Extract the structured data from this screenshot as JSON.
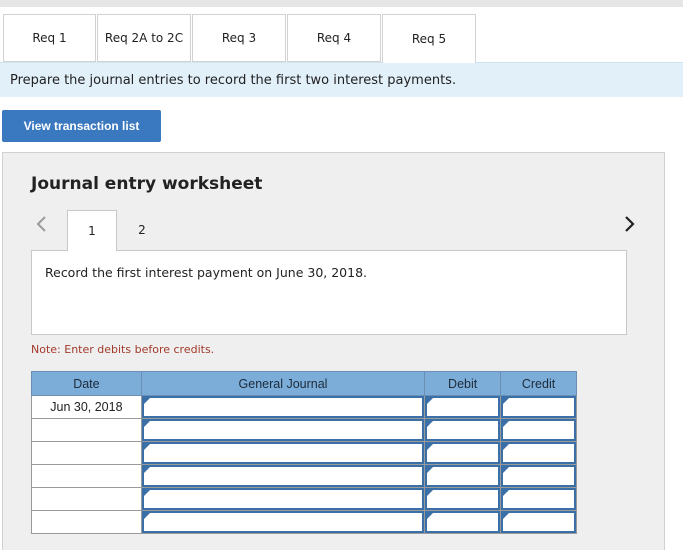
{
  "tabs": [
    {
      "label": "Req 1",
      "active": false
    },
    {
      "label": "Req 2A to 2C",
      "active": false
    },
    {
      "label": "Req 3",
      "active": false
    },
    {
      "label": "Req 4",
      "active": false
    },
    {
      "label": "Req 5",
      "active": true
    }
  ],
  "instruction": "Prepare the journal entries to record the first two interest payments.",
  "view_transaction_button": "View transaction list",
  "worksheet": {
    "title": "Journal entry worksheet",
    "pages": [
      "1",
      "2"
    ],
    "active_page": "1",
    "record_text": "Record the first interest payment on June 30, 2018.",
    "note": "Note: Enter debits before credits."
  },
  "table": {
    "headers": {
      "date": "Date",
      "journal": "General Journal",
      "debit": "Debit",
      "credit": "Credit"
    },
    "rows": [
      {
        "date": "Jun 30, 2018",
        "account": "",
        "debit": "",
        "credit": ""
      },
      {
        "date": "",
        "account": "",
        "debit": "",
        "credit": ""
      },
      {
        "date": "",
        "account": "",
        "debit": "",
        "credit": ""
      },
      {
        "date": "",
        "account": "",
        "debit": "",
        "credit": ""
      },
      {
        "date": "",
        "account": "",
        "debit": "",
        "credit": ""
      },
      {
        "date": "",
        "account": "",
        "debit": "",
        "credit": ""
      }
    ]
  },
  "colors": {
    "accent": "#3a78c0",
    "header_bg": "#7badd8",
    "note": "#a33a2a",
    "instruction_bg": "#e2f0fa"
  },
  "icons": {
    "prev": "chevron-left-icon",
    "next": "chevron-right-icon"
  }
}
